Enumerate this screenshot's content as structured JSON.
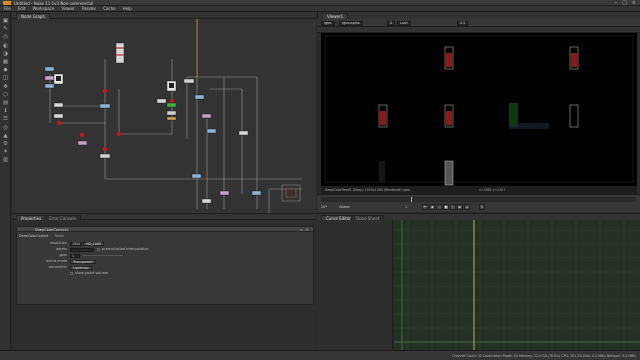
{
  "window": {
    "title": "Untitled - Nuke 11.1v3 Non-commercial",
    "app_icon": "nuke-icon",
    "controls": [
      "minimize-icon",
      "maximize-icon",
      "close-icon"
    ]
  },
  "menubar": [
    "File",
    "Edit",
    "Workspace",
    "Viewer",
    "Render",
    "Cache",
    "Help"
  ],
  "toolbar": {
    "icons": [
      "image-icon",
      "draw-icon",
      "time-icon",
      "channel-icon",
      "color-icon",
      "filter-icon",
      "keyer-icon",
      "merge-icon",
      "transform-icon",
      "3d-icon",
      "views-icon",
      "metadata-icon",
      "toolsets-icon",
      "other-icon",
      "furnace-icon",
      "gear-icon",
      "particles-icon",
      "deep-icon"
    ]
  },
  "node_graph": {
    "tabs": [
      "Node Graph"
    ]
  },
  "properties": {
    "tabs": [
      "Properties",
      "Error Console"
    ],
    "node_name": "DeepColorCorrect1",
    "node_tabs": [
      "DeepColorCorrect",
      "Node"
    ],
    "rows": [
      {
        "label": "resolution",
        "value": "HD_1080",
        "extra": "1920"
      },
      {
        "label": "delete",
        "value": "",
        "check_label": "premultiplied interpolation"
      },
      {
        "label": "gain",
        "value": "1"
      },
      {
        "label": "blend mode",
        "value": "Transparent"
      },
      {
        "label": "volumetric",
        "value": "Lightmap"
      },
      {
        "label": "",
        "value": "",
        "check_label": "show point volume"
      }
    ]
  },
  "viewer": {
    "tabs": [
      "Viewer1"
    ],
    "channel_set": "rgba",
    "channel": "rgba.alpha",
    "layer_label": "A",
    "layer_value": "Lash",
    "zoom": "0.5",
    "info_left": "DeepColorRead1 (Deep) 1920x1080 (Rendered) rgba",
    "info_right": "x=1882 y=1107"
  },
  "timeline": {
    "start": "1",
    "end": "100",
    "fps": "24*",
    "mode": "Global",
    "frame": "1"
  },
  "curve_editor": {
    "tabs": [
      "Curve Editor",
      "Dope Sheet"
    ]
  },
  "statusbar": {
    "text": "Channel Count: 42 Localization Mode: On Memory: 12.9 GB (76.6%) CPU: 201.2% Disk: 0.0 MB/s Network: 0.0 MB/s"
  }
}
